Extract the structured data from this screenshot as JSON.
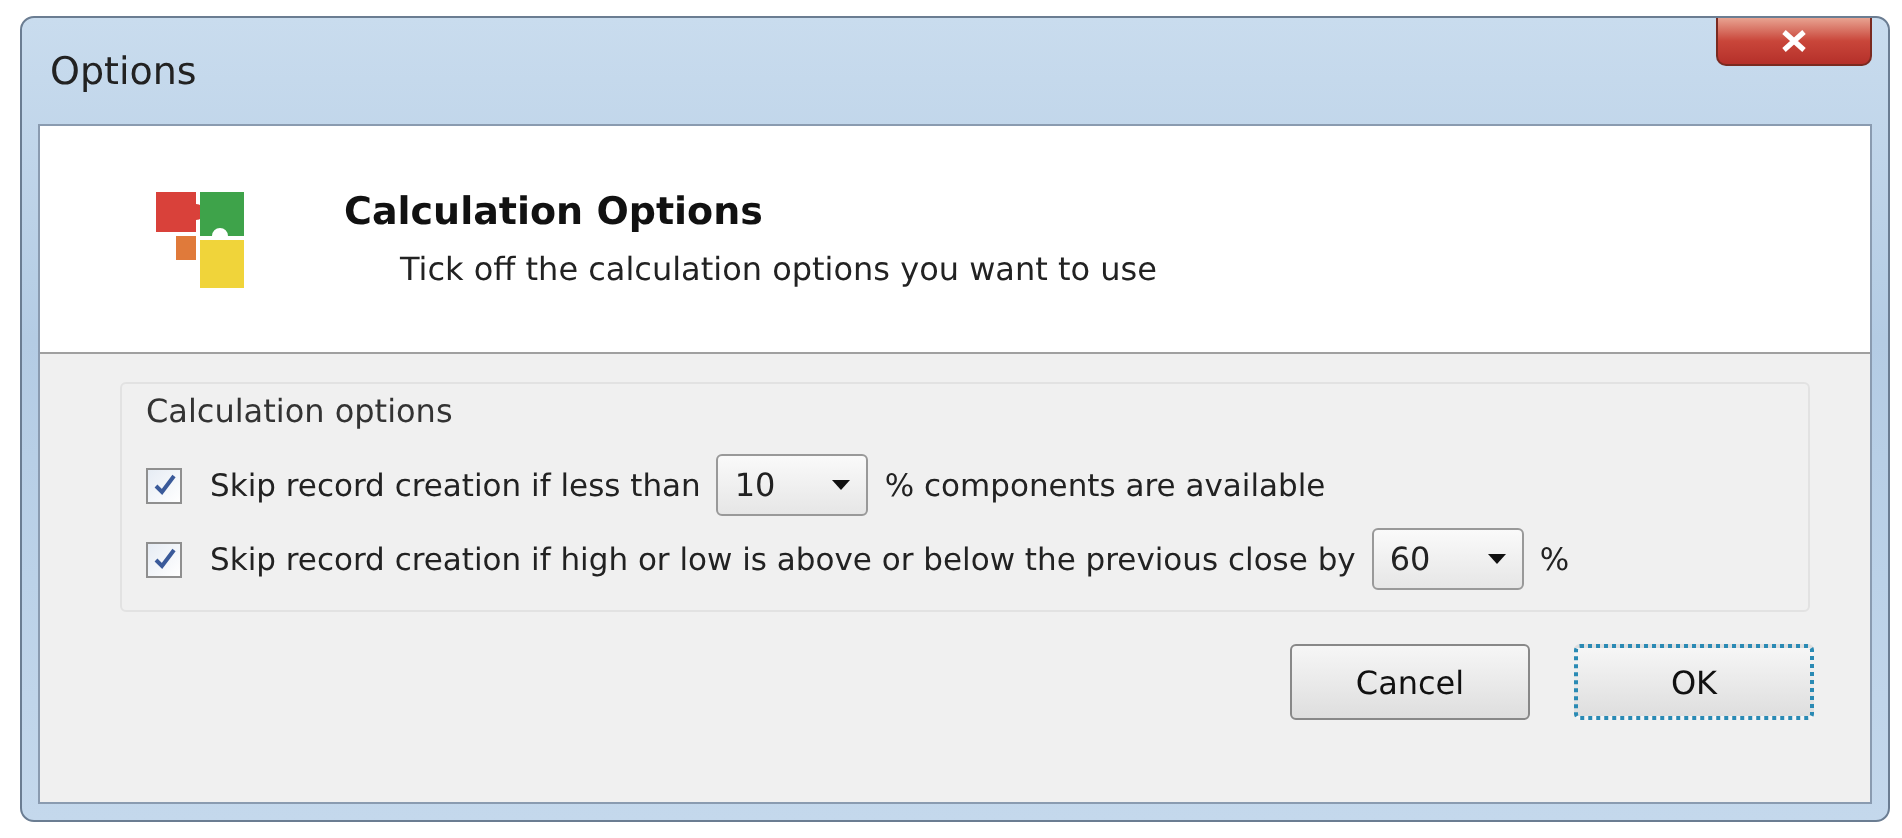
{
  "window": {
    "title": "Options"
  },
  "header": {
    "title": "Calculation Options",
    "subtitle": "Tick off the calculation options you want to use"
  },
  "group": {
    "title": "Calculation options",
    "options": [
      {
        "checked": true,
        "label_before": "Skip record creation if less than",
        "value": "10",
        "label_after": "% components are available"
      },
      {
        "checked": true,
        "label_before": "Skip record creation if high or low is above or below the previous close by",
        "value": "60",
        "label_after": "%"
      }
    ]
  },
  "buttons": [
    {
      "label": "Cancel",
      "default": false
    },
    {
      "label": "OK",
      "default": true
    }
  ]
}
